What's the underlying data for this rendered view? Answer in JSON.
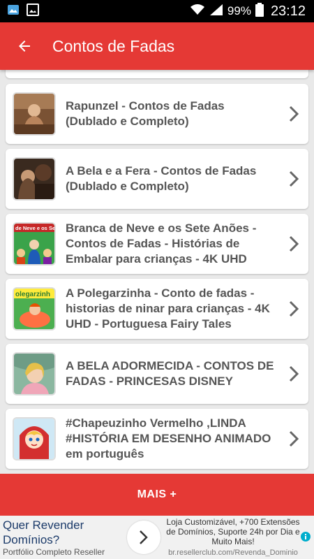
{
  "status_bar": {
    "battery": "99%",
    "time": "23:12"
  },
  "app_bar": {
    "title": "Contos de Fadas"
  },
  "videos": [
    {
      "title": "Rapunzel - Contos de Fadas (Dublado e Completo)"
    },
    {
      "title": "A Bela e a Fera - Contos de Fadas (Dublado e Completo)"
    },
    {
      "title": "Branca de Neve e os Sete Anões - Contos de Fadas - Histórias de Embalar para crianças  - 4K UHD",
      "thumb_text": "de Neve e os Sete"
    },
    {
      "title": "A Polegarzinha - Conto de fadas - historias de ninar para crianças - 4K UHD - Portuguesa Fairy Tales",
      "thumb_text": "olegarzinh"
    },
    {
      "title": "A BELA ADORMECIDA - CONTOS DE FADAS - PRINCESAS DISNEY"
    },
    {
      "title": "#Chapeuzinho Vermelho ,LINDA #HISTÓRIA EM DESENHO ANIMADO em português"
    }
  ],
  "more_button": {
    "label": "MAIS +"
  },
  "ad": {
    "headline": "Quer Revender Domínios?",
    "subline": "Portfólio Completo Reseller",
    "description": "Loja Customizável, +700 Extensões de Domínios, Suporte 24h por Dia e Muito Mais!",
    "url": "br.resellerclub.com/Revenda_Dominio"
  },
  "colors": {
    "accent": "#e53935",
    "background": "#e9e9e9",
    "title_text": "#555555"
  }
}
